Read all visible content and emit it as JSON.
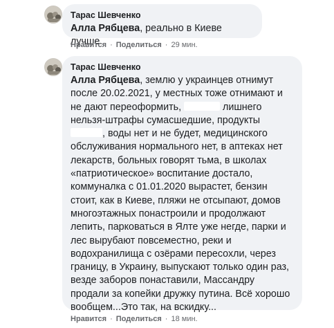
{
  "comments": [
    {
      "author": "Тарас Шевченко",
      "mention": "Алла Рябцева",
      "text": ", реально в Киеве лучше.",
      "like_label": "Нравится",
      "share_label": "Поделиться",
      "time": "29 мин."
    },
    {
      "author": "Тарас Шевченко",
      "mention": "Алла Рябцева",
      "text_a": ", землю у украинцев отнимут после 20.02.2021, у местных тоже отнимают и не дают переоформить, ",
      "text_b": " лишнего нельзя-штрафы сумасшедшие, продукты ",
      "text_c": ", воды нет и не будет, медицинского обслуживания нормального нет, в аптеках нет лекарств, больных говорят тьма, в школах «патриотическое» воспитание достало, коммуналка с 01.01.2020 вырастет, бензин стоит, как в Киеве, пляжи не отсыпают, домов многоэтажных понастроили и продолжают лепить, парковаться в Ялте уже негде, парки и лес вырубают повсеместно, реки и водохранилища с озёрами пересохли, через границу, в Украину, выпускают только один раз, везде заборов понаставили, Массандру продали за копейки дружку путина. Всё хорошо вообщем...Это так, на вскидку...",
      "like_label": "Нравится",
      "share_label": "Поделиться",
      "time": "18 мин."
    }
  ],
  "separator": "·"
}
